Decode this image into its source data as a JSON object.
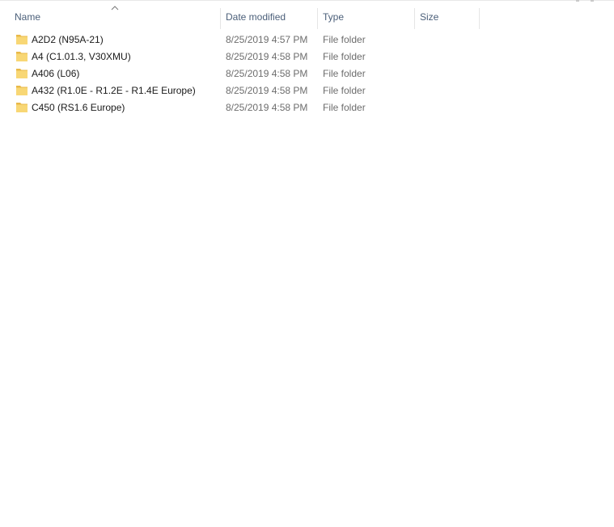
{
  "columns": {
    "name": "Name",
    "date_modified": "Date modified",
    "type": "Type",
    "size": "Size"
  },
  "sort": {
    "column": "name",
    "direction": "ascending",
    "icon": "chevron-up-icon"
  },
  "colors": {
    "header_text": "#4c607a",
    "folder_fill": "#f8d775",
    "folder_back": "#e9b949"
  },
  "items": [
    {
      "name": "A2D2 (N95A-21)",
      "date_modified": "8/25/2019 4:57 PM",
      "type": "File folder",
      "size": "",
      "icon": "folder-icon"
    },
    {
      "name": "A4 (C1.01.3, V30XMU)",
      "date_modified": "8/25/2019 4:58 PM",
      "type": "File folder",
      "size": "",
      "icon": "folder-icon"
    },
    {
      "name": "A406 (L06)",
      "date_modified": "8/25/2019 4:58 PM",
      "type": "File folder",
      "size": "",
      "icon": "folder-icon"
    },
    {
      "name": "A432 (R1.0E - R1.2E - R1.4E Europe)",
      "date_modified": "8/25/2019 4:58 PM",
      "type": "File folder",
      "size": "",
      "icon": "folder-icon"
    },
    {
      "name": "C450 (RS1.6 Europe)",
      "date_modified": "8/25/2019 4:58 PM",
      "type": "File folder",
      "size": "",
      "icon": "folder-icon"
    }
  ]
}
